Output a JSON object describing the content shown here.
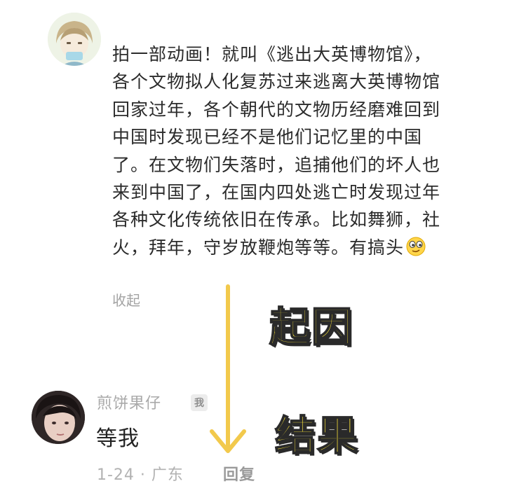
{
  "comment": {
    "avatar_icon": "anime-avatar-icon",
    "lines": [
      "拍一部动画！就叫《逃出大英博物馆》，",
      "各个文物拟人化复苏过来逃离大英博物馆",
      "回家过年，各个朝代的文物历经磨难回到",
      "中国时发现已经不是他们记忆里的中国",
      "了。在文物们失落时，追捕他们的坏人也",
      "来到中国了，在国内四处逃亡时发现过年",
      "各种文化传统依旧在传承。比如舞狮，社",
      "火，拜年，守岁放鞭炮等等。有搞头"
    ],
    "emoji_icon": "smirk-emoji-icon",
    "collapse_label": "收起"
  },
  "annotations": {
    "cause_label": "起因",
    "result_label": "结果",
    "arrow_icon": "down-arrow-icon",
    "arrow_color": "#f2c94c",
    "label_color": "#ffe83a"
  },
  "reply": {
    "avatar_icon": "user-photo-avatar",
    "username": "煎饼果仔",
    "me_badge": "我",
    "text": "等我",
    "meta": "1-24 · 广东",
    "reply_label": "回复"
  }
}
